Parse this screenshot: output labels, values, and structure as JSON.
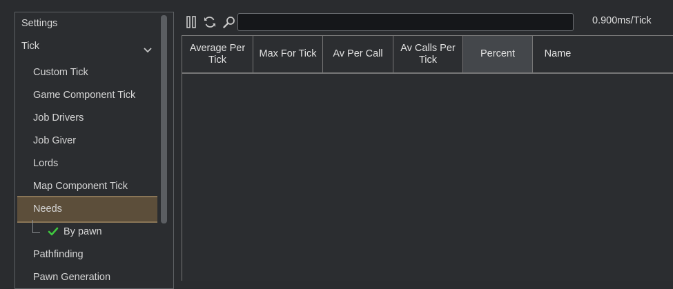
{
  "sidebar": {
    "settings_label": "Settings",
    "tick_label": "Tick",
    "items": [
      {
        "label": "Custom Tick"
      },
      {
        "label": "Game Component Tick"
      },
      {
        "label": "Job Drivers"
      },
      {
        "label": "Job Giver"
      },
      {
        "label": "Lords"
      },
      {
        "label": "Map Component Tick"
      },
      {
        "label": "Needs"
      },
      {
        "label": "By pawn"
      },
      {
        "label": "Pathfinding"
      },
      {
        "label": "Pawn Generation"
      }
    ]
  },
  "toolbar": {
    "search_value": "",
    "ms_per_tick": "0.900ms/Tick"
  },
  "table": {
    "columns": [
      {
        "label_line1": "Average Per",
        "label_line2": "Tick"
      },
      {
        "label_line1": "Max For Tick",
        "label_line2": ""
      },
      {
        "label_line1": "Av Per Call",
        "label_line2": ""
      },
      {
        "label_line1": "Av Calls Per",
        "label_line2": "Tick"
      },
      {
        "label_line1": "Percent",
        "label_line2": ""
      },
      {
        "label_line1": "Name",
        "label_line2": ""
      }
    ]
  },
  "colors": {
    "selected_row": "#5c4e3a",
    "check_green": "#3fc83f"
  }
}
